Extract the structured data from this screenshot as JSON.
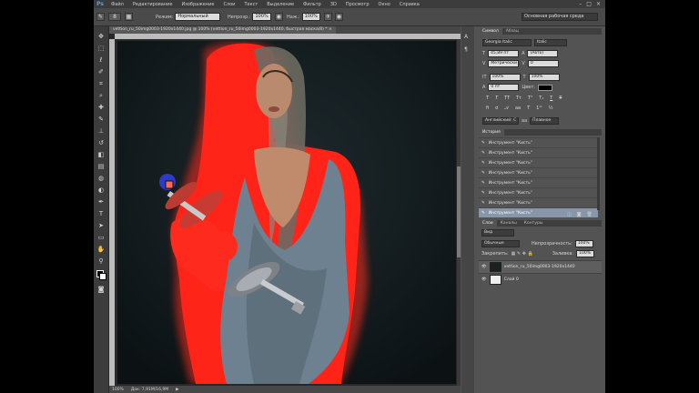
{
  "app": {
    "logo": "Ps"
  },
  "menu": {
    "items": [
      "Файл",
      "Редактирование",
      "Изображение",
      "Слои",
      "Текст",
      "Выделение",
      "Фильтр",
      "3D",
      "Просмотр",
      "Окно",
      "Справка"
    ]
  },
  "options": {
    "brush_size": "8",
    "mode_label": "Режим:",
    "mode_value": "Нормальный",
    "opacity_label": "Непрозр.:",
    "opacity_value": "100%",
    "pressure_label": "Наж.:",
    "pressure_value": "100%",
    "workspace": "Основная рабочая среда"
  },
  "document": {
    "tab_title": "vettion_ru_50img0003-1920x1440.jpg @ 100% (vettion_ru_50img0003-1920x1440, быстрая маска/8) *",
    "zoom": "100%",
    "doc_info": "Док: 7,91M/16,9M"
  },
  "character_panel": {
    "tabs": [
      "Символ",
      "Абзац"
    ],
    "font_family": "Georgia Italic",
    "font_style": "Italic",
    "font_size": "45,89 пт",
    "leading": "(Авто)",
    "kerning": "Метрически",
    "tracking": "0",
    "vscale": "100%",
    "hscale": "100%",
    "baseline": "0 пт",
    "color_label": "Цвет:",
    "language": "Английский: С",
    "antialias": "Плавное"
  },
  "history_panel": {
    "tabs": [
      "История"
    ],
    "items": [
      "Инструмент \"Кисть\"",
      "Инструмент \"Кисть\"",
      "Инструмент \"Кисть\"",
      "Инструмент \"Кисть\"",
      "Инструмент \"Кисть\"",
      "Инструмент \"Кисть\"",
      "Инструмент \"Кисть\"",
      "Инструмент \"Кисть\""
    ]
  },
  "layers_panel": {
    "tabs": [
      "Слои",
      "Каналы",
      "Контуры"
    ],
    "filter": "Вид",
    "blend_mode": "Обычные",
    "opacity_label": "Непрозрачность:",
    "opacity_value": "100%",
    "lock_label": "Закрепить:",
    "fill_label": "Заливка:",
    "fill_value": "100%",
    "layers": [
      "vettion_ru_50img0003-1920x1440",
      "Слой 0"
    ]
  },
  "icons": [
    "brush-icon",
    "move-icon",
    "marquee-icon",
    "lasso-icon",
    "quick-select-icon",
    "crop-icon",
    "eyedropper-icon",
    "healing-icon",
    "stamp-icon",
    "history-brush-icon",
    "eraser-icon",
    "gradient-icon",
    "blur-icon",
    "dodge-icon",
    "pen-icon",
    "type-icon",
    "path-select-icon",
    "shape-icon",
    "hand-icon",
    "zoom-icon",
    "eye-icon",
    "lock-icon"
  ],
  "colors": {
    "mask_red": "#ff1e1e",
    "chrome_dark": "#3c3c3c",
    "panel": "#535353",
    "selected_history": "#8896aa"
  }
}
